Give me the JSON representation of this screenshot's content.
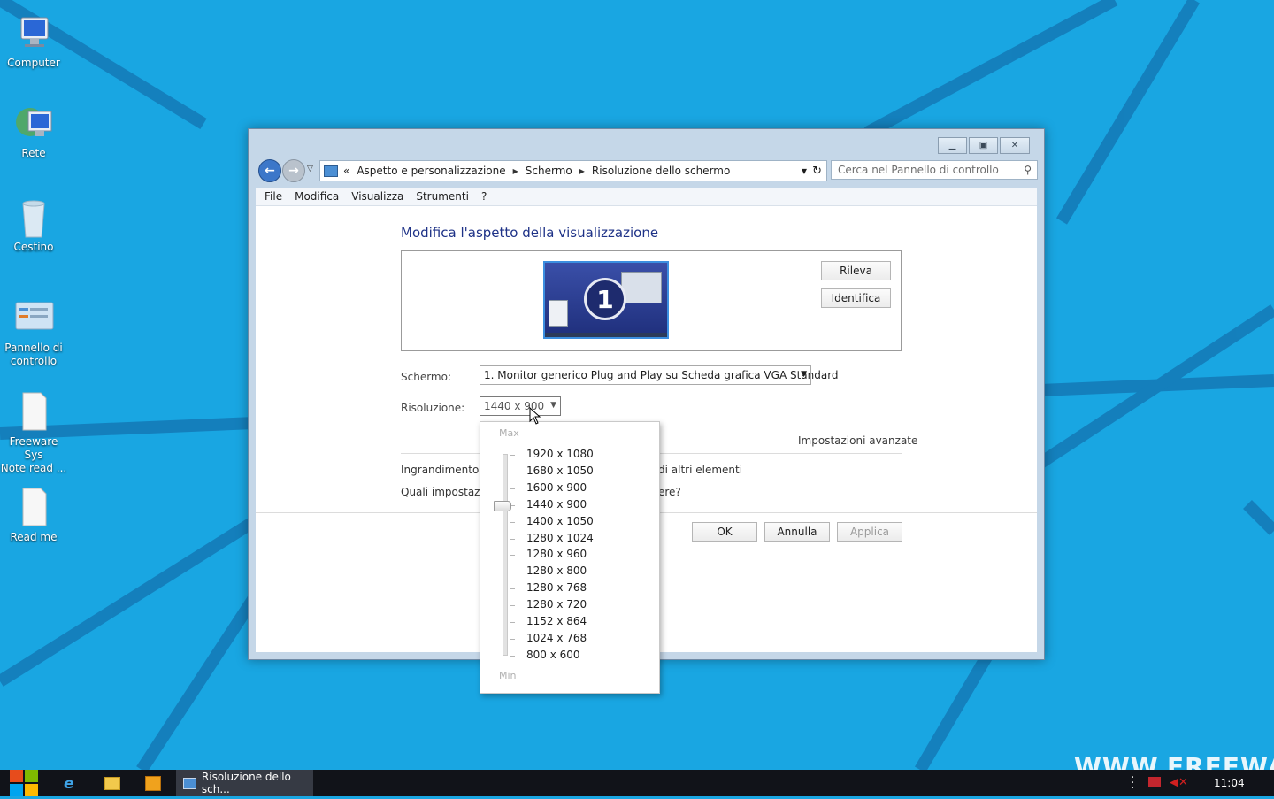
{
  "desktop": {
    "icons": [
      {
        "label_line1": "Computer",
        "label_line2": ""
      },
      {
        "label_line1": "Rete",
        "label_line2": ""
      },
      {
        "label_line1": "Cestino",
        "label_line2": ""
      },
      {
        "label_line1": "Pannello di",
        "label_line2": "controllo"
      },
      {
        "label_line1": "Freeware Sys",
        "label_line2": "Note read ..."
      },
      {
        "label_line1": "Read me",
        "label_line2": ""
      }
    ],
    "watermark": "WWW.FREEWARESY"
  },
  "window": {
    "breadcrumb": {
      "prefix": "«",
      "items": [
        "Aspetto e personalizzazione",
        "Schermo",
        "Risoluzione dello schermo"
      ]
    },
    "search_placeholder": "Cerca nel Pannello di controllo",
    "menu": [
      "File",
      "Modifica",
      "Visualizza",
      "Strumenti",
      "?"
    ],
    "heading": "Modifica l'aspetto della visualizzazione",
    "monitor_number": "1",
    "detect_button": "Rileva",
    "identify_button": "Identifica",
    "display_label": "Schermo:",
    "display_value": "1. Monitor generico Plug and Play su Scheda grafica VGA Standard",
    "resolution_label": "Risoluzione:",
    "resolution_value": "1440 x 900",
    "advanced_link": "Impostazioni avanzate",
    "link1_start": "Ingrandimento o",
    "link1_end": "di altri elementi",
    "link2_start": "Quali impostazio",
    "link2_end": "ere?",
    "ok_button": "OK",
    "cancel_button": "Annulla",
    "apply_button": "Applica"
  },
  "resolution_dropdown": {
    "max_label": "Max",
    "min_label": "Min",
    "options": [
      "1920 x 1080",
      "1680 x 1050",
      "1600 x 900",
      "1440 x 900",
      "1400 x 1050",
      "1280 x 1024",
      "1280 x 960",
      "1280 x 800",
      "1280 x 768",
      "1280 x 720",
      "1152 x 864",
      "1024 x 768",
      "800 x 600"
    ],
    "selected_index": 3
  },
  "taskbar": {
    "task_label": "Risoluzione dello sch...",
    "clock": "11:04"
  },
  "colors": {
    "desktop_bg": "#19a6e2",
    "taskbar_bg": "#111319",
    "nav_accent": "#3c77c9"
  }
}
